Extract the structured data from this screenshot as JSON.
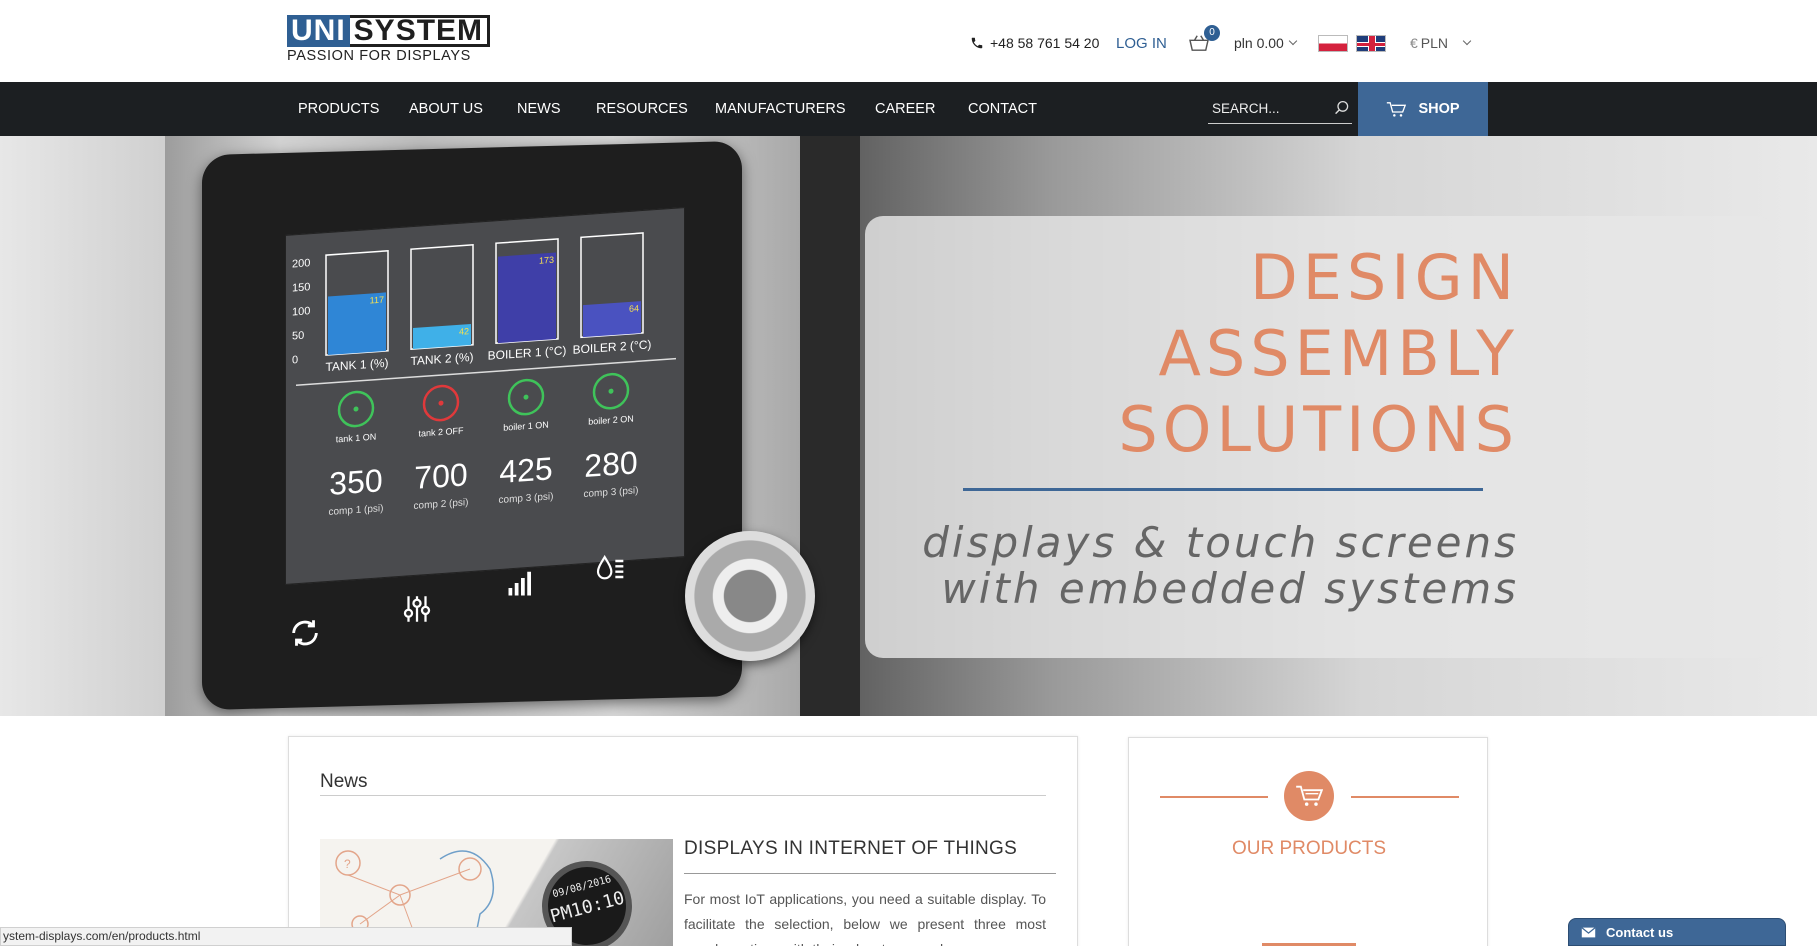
{
  "header": {
    "logo": {
      "brand_part1": "UNI",
      "brand_part2": "SYSTEM",
      "tagline": "PASSION FOR DISPLAYS"
    },
    "phone": "+48 58 761 54 20",
    "login": "LOG IN",
    "cart_count": "0",
    "price": "pln 0.00",
    "currency": "PLN",
    "languages": [
      "pl-flag",
      "uk-flag"
    ]
  },
  "nav": {
    "items": [
      "PRODUCTS",
      "ABOUT US",
      "NEWS",
      "RESOURCES",
      "MANUFACTURERS",
      "CAREER",
      "CONTACT"
    ],
    "search_placeholder": "SEARCH...",
    "shop": "SHOP"
  },
  "hero": {
    "lines": [
      "DESIGN",
      "ASSEMBLY",
      "SOLUTIONS"
    ],
    "subtitle_lines": [
      "displays & touch screens",
      "with embedded systems"
    ],
    "screen": {
      "y_ticks": [
        "200",
        "150",
        "100",
        "50",
        "0"
      ],
      "bars": [
        {
          "label": "TANK 1 (%)",
          "value": "117",
          "level": 0.585,
          "color": "#2f86d6"
        },
        {
          "label": "TANK 2 (%)",
          "value": "42",
          "level": 0.21,
          "color": "#3fb0e8"
        },
        {
          "label": "BOILER 1 (°C)",
          "value": "173",
          "level": 0.865,
          "color": "#3f3fa8"
        },
        {
          "label": "BOILER 2 (°C)",
          "value": "64",
          "level": 0.32,
          "color": "#4a52c0"
        }
      ],
      "indicators": [
        {
          "label": "tank 1 ON",
          "color": "#3fc35a"
        },
        {
          "label": "tank 2 OFF",
          "color": "#e0393b"
        },
        {
          "label": "boiler 1 ON",
          "color": "#3fc35a"
        },
        {
          "label": "boiler 2 ON",
          "color": "#3fc35a"
        }
      ],
      "readouts": [
        {
          "value": "350",
          "label": "comp 1 (psi)"
        },
        {
          "value": "700",
          "label": "comp 2 (psi)"
        },
        {
          "value": "425",
          "label": "comp 3 (psi)"
        },
        {
          "value": "280",
          "label": "comp 3 (psi)"
        }
      ]
    }
  },
  "news": {
    "title": "News",
    "article": {
      "title": "DISPLAYS IN INTERNET OF THINGS",
      "text": "For most IoT applications, you need a suitable display. To facilitate the selection, below we present three most popular options with their advantages and",
      "watch_time": "PM10:10",
      "watch_date": "09/08/2016"
    }
  },
  "products": {
    "title": "OUR PRODUCTS"
  },
  "status_bar": {
    "url": "ystem-displays.com/en/products.html"
  },
  "contact_tab": {
    "label": "Contact us"
  },
  "colors": {
    "brand_blue": "#3e6796",
    "accent_orange": "#e08a66",
    "nav_dark": "#1c1f22"
  }
}
